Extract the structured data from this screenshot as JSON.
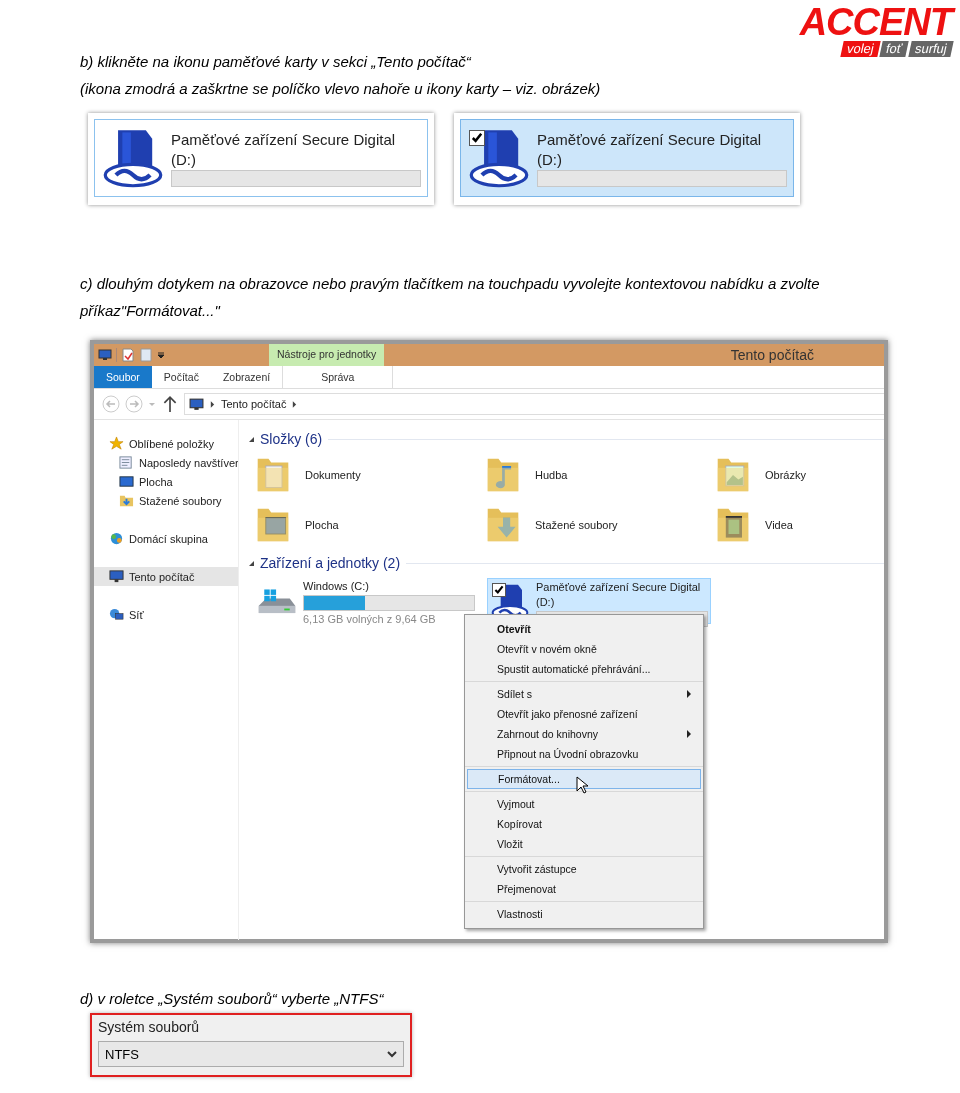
{
  "logo": {
    "name": "ACCENT",
    "taglines": [
      "volej",
      "foť",
      "surfuj"
    ]
  },
  "step_b": {
    "lines": [
      "b) klikněte na ikonu paměťové karty v sekci „Tento počítač“",
      "(ikona zmodrá a zaškrtne se políčko vlevo nahoře u ikony karty – viz. obrázek)"
    ]
  },
  "cards": [
    {
      "name": "Paměťové zařízení Secure Digital",
      "letter": "(D:)",
      "selected": false
    },
    {
      "name": "Paměťové zařízení Secure Digital",
      "letter": "(D:)",
      "selected": true
    }
  ],
  "step_c": {
    "lines": [
      "c) dlouhým dotykem na obrazovce nebo pravým tlačítkem na touchpadu vyvolejte kontextovou nabídku a zvolte",
      "příkaz\"Formátovat...\""
    ]
  },
  "explorer": {
    "title": "Tento počítač",
    "context_tab": "Nástroje pro jednotky",
    "ribbon_tabs": [
      {
        "label": "Soubor",
        "selected": true
      },
      {
        "label": "Počítač",
        "selected": false
      },
      {
        "label": "Zobrazení",
        "selected": false
      },
      {
        "label": "Správa",
        "selected": false
      }
    ],
    "address": [
      "Tento počítač"
    ],
    "nav": [
      {
        "label": "Oblíbené položky",
        "selected": false,
        "children": [
          {
            "label": "Naposledy navštíver",
            "selected": false
          },
          {
            "label": "Plocha",
            "selected": false
          },
          {
            "label": "Stažené soubory",
            "selected": false
          }
        ]
      },
      {
        "label": "Domácí skupina",
        "selected": false
      },
      {
        "label": "Tento počítač",
        "selected": true
      },
      {
        "label": "Síť",
        "selected": false
      }
    ],
    "folders_header": "Složky (6)",
    "folders": [
      "Dokumenty",
      "Hudba",
      "Obrázky",
      "Plocha",
      "Stažené soubory",
      "Videa"
    ],
    "drives_header": "Zařízení a jednotky (2)",
    "drives": [
      {
        "name": "Windows (C:)",
        "level": 0.36,
        "caption": "6,13 GB volných z 9,64 GB",
        "selected": false
      },
      {
        "name": "Paměťové zařízení Secure Digital",
        "letter": "(D:)",
        "selected": true
      }
    ],
    "context_menu": [
      {
        "items": [
          {
            "label": "Otevřít",
            "default": true,
            "submenu": false,
            "selected": false
          },
          {
            "label": "Otevřít v novém okně",
            "default": false,
            "submenu": false,
            "selected": false
          },
          {
            "label": "Spustit automatické přehrávání...",
            "default": false,
            "submenu": false,
            "selected": false
          }
        ]
      },
      {
        "items": [
          {
            "label": "Sdílet s",
            "default": false,
            "submenu": true,
            "selected": false
          },
          {
            "label": "Otevřít jako přenosné zařízení",
            "default": false,
            "submenu": false,
            "selected": false
          },
          {
            "label": "Zahrnout do knihovny",
            "default": false,
            "submenu": true,
            "selected": false
          },
          {
            "label": "Připnout na Úvodní obrazovku",
            "default": false,
            "submenu": false,
            "selected": false
          }
        ]
      },
      {
        "items": [
          {
            "label": "Formátovat...",
            "default": false,
            "submenu": false,
            "selected": true
          }
        ]
      },
      {
        "items": [
          {
            "label": "Vyjmout",
            "default": false,
            "submenu": false,
            "selected": false
          },
          {
            "label": "Kopírovat",
            "default": false,
            "submenu": false,
            "selected": false
          },
          {
            "label": "Vložit",
            "default": false,
            "submenu": false,
            "selected": false
          }
        ]
      },
      {
        "items": [
          {
            "label": "Vytvořit zástupce",
            "default": false,
            "submenu": false,
            "selected": false
          },
          {
            "label": "Přejmenovat",
            "default": false,
            "submenu": false,
            "selected": false
          }
        ]
      },
      {
        "items": [
          {
            "label": "Vlastnosti",
            "default": false,
            "submenu": false,
            "selected": false
          }
        ]
      }
    ]
  },
  "step_d": {
    "text": "d) v roletce „Systém souborů“ vyberte „NTFS“"
  },
  "fs_select": {
    "label": "Systém souborů",
    "value": "NTFS"
  }
}
